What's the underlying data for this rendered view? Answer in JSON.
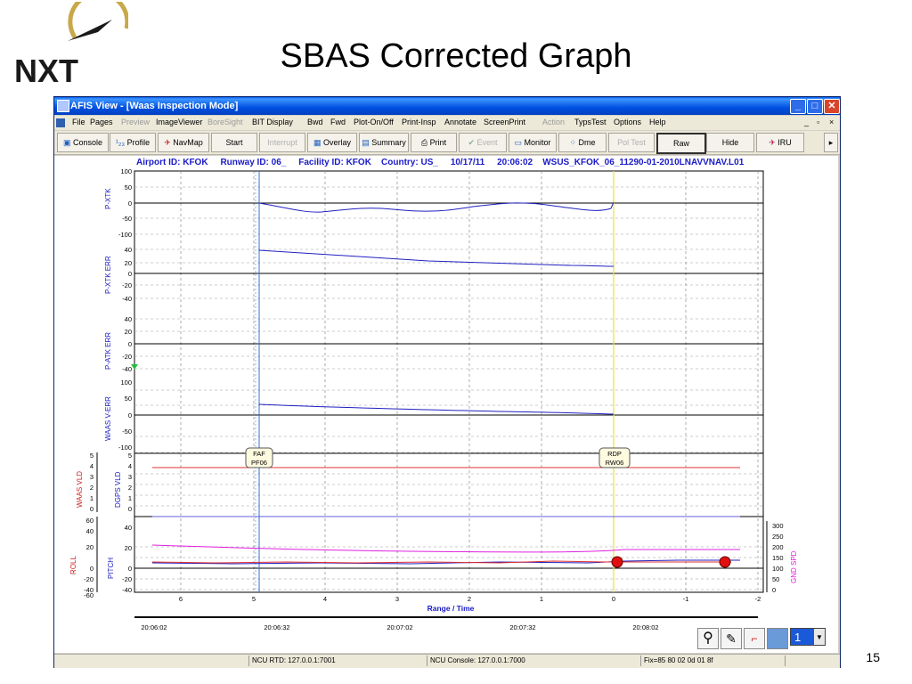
{
  "slide": {
    "title": "SBAS Corrected Graph",
    "page_number": "15",
    "logo_text": "NXT"
  },
  "window": {
    "title": "AFIS View - [Waas Inspection Mode]",
    "controls": [
      "_",
      "□",
      "✕"
    ]
  },
  "menu": {
    "items": [
      {
        "label": "File",
        "enabled": true
      },
      {
        "label": "Pages",
        "enabled": true
      },
      {
        "label": "Preview",
        "enabled": false
      },
      {
        "label": "ImageViewer",
        "enabled": true
      },
      {
        "label": "BoreSight",
        "enabled": false
      },
      {
        "label": "BIT Display",
        "enabled": true
      },
      {
        "label": "Bwd",
        "enabled": true
      },
      {
        "label": "Fwd",
        "enabled": true
      },
      {
        "label": "Plot-On/Off",
        "enabled": true
      },
      {
        "label": "Print-Insp",
        "enabled": true
      },
      {
        "label": "Annotate",
        "enabled": true
      },
      {
        "label": "ScreenPrint",
        "enabled": true
      },
      {
        "label": "Action",
        "enabled": false
      },
      {
        "label": "TypsTest",
        "enabled": true
      },
      {
        "label": "Options",
        "enabled": true
      },
      {
        "label": "Help",
        "enabled": true
      }
    ],
    "mdi_controls": [
      "_",
      "▫",
      "×"
    ]
  },
  "toolbar": {
    "buttons": [
      {
        "label": "Console",
        "icon": "console-icon",
        "enabled": true
      },
      {
        "label": "Profile",
        "icon": "profile-icon",
        "enabled": true
      },
      {
        "label": "NavMap",
        "icon": "airplane-icon",
        "enabled": true
      },
      {
        "label": "Start",
        "icon": "",
        "enabled": true
      },
      {
        "label": "Interrupt",
        "icon": "",
        "enabled": false
      },
      {
        "label": "Overlay",
        "icon": "overlay-icon",
        "enabled": true
      },
      {
        "label": "Summary",
        "icon": "summary-icon",
        "enabled": true
      },
      {
        "label": "Print",
        "icon": "printer-icon",
        "enabled": true
      },
      {
        "label": "Event",
        "icon": "check-icon",
        "enabled": false
      },
      {
        "label": "Monitor",
        "icon": "monitor-icon",
        "enabled": true
      },
      {
        "label": "Dme",
        "icon": "dme-icon",
        "enabled": true
      },
      {
        "label": "Pol Test",
        "icon": "",
        "enabled": false
      },
      {
        "label": "Raw",
        "icon": "",
        "enabled": true
      },
      {
        "label": "Hide",
        "icon": "",
        "enabled": true
      },
      {
        "label": "IRU",
        "icon": "jet-icon",
        "enabled": true
      }
    ]
  },
  "header_line": "Airport ID: KFOK     Runway ID: 06_     Facility ID: KFOK    Country: US_     10/17/11     20:06:02    WSUS_KFOK_06_11290-01-2010LNAVVNAV.L01",
  "panels": {
    "pxtk": {
      "label": "P-XTK",
      "ticks": [
        "100",
        "50",
        "0",
        "-50",
        "-100"
      ]
    },
    "pxtk_err": {
      "label": "P-XTK ERR",
      "ticks": [
        "40",
        "20",
        "0",
        "-20",
        "-40"
      ]
    },
    "patk_err": {
      "label": "P-ATK ERR",
      "ticks": [
        "40",
        "20",
        "0",
        "-20",
        "-40"
      ]
    },
    "waas_verr": {
      "label": "WAAS V-ERR",
      "ticks": [
        "100",
        "50",
        "0",
        "-50",
        "-100"
      ]
    },
    "vld": {
      "label_left": "WAAS VLD",
      "label_right": "DGPS VLD",
      "ticks": [
        "5",
        "4",
        "3",
        "2",
        "1",
        "0"
      ]
    },
    "attitude": {
      "label_left": "ROLL",
      "label_right": "PITCH",
      "ticks_left": [
        "60",
        "40",
        "20",
        "0",
        "-20",
        "-40",
        "-60"
      ],
      "ticks_inner": [
        "40",
        "20",
        "0",
        "-20",
        "-40"
      ],
      "ticks_right": [
        "300",
        "250",
        "200",
        "150",
        "100",
        "50",
        "0"
      ],
      "label_far_right": "GND SPD"
    }
  },
  "markers": {
    "faf": {
      "line1": "FAF",
      "line2": "PF06"
    },
    "rdp": {
      "line1": "RDP",
      "line2": "RW06"
    }
  },
  "x_axis": {
    "label": "Range / Time",
    "range_ticks": [
      "6",
      "5",
      "4",
      "3",
      "2",
      "1",
      "0",
      "-1",
      "-2"
    ],
    "time_ticks": [
      "20:06:02",
      "20:06:32",
      "20:07:02",
      "20:07:32",
      "20:08:02"
    ]
  },
  "tools": {
    "page_value": "1"
  },
  "status": {
    "ncu_rtd": "NCU RTD:  127.0.0.1:7001",
    "ncu_console": "NCU Console:  127.0.0.1:7000",
    "fix": "Fix=85 80 02 0d 01 8f"
  },
  "colors": {
    "title_bar": "#0050e0",
    "header_text": "#1a1ac8",
    "trace_blue": "#2020c0",
    "red_line": "#e03030",
    "magenta": "#e020e0",
    "faf_line": "#3070d0",
    "rdp_line": "#e8e040"
  }
}
